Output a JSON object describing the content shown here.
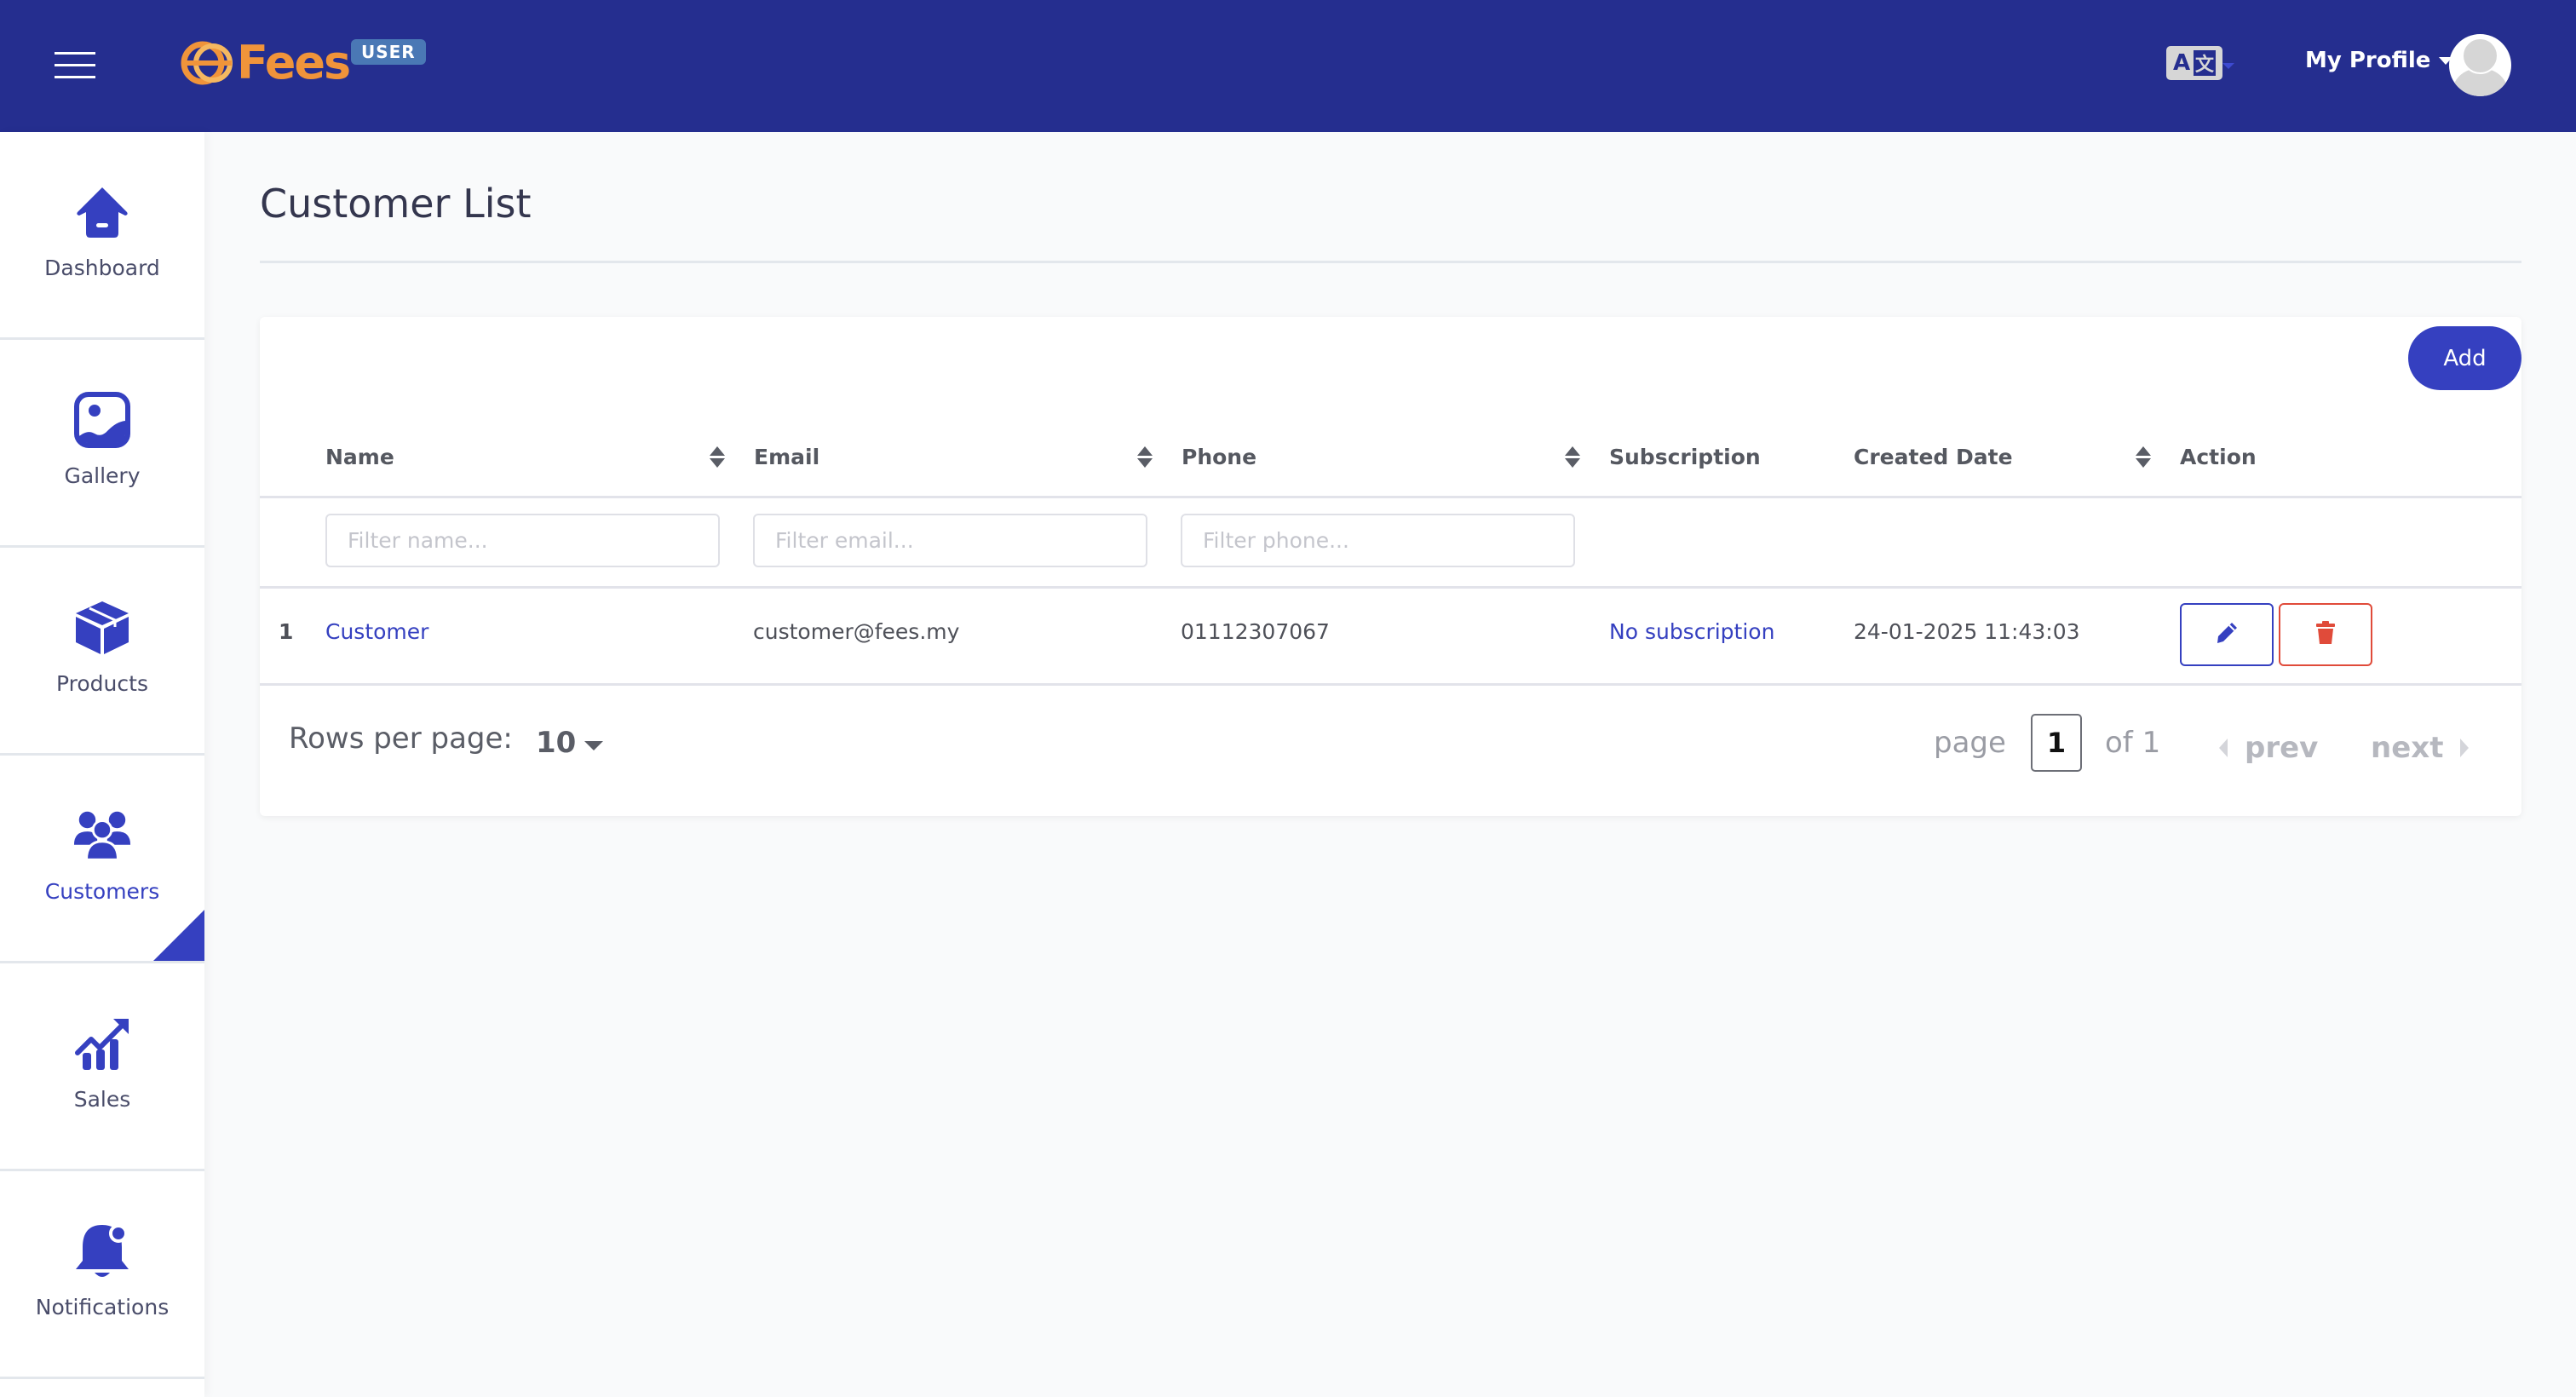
{
  "header": {
    "brand": "Fees",
    "role_badge": "USER",
    "language_icon": {
      "latin": "A",
      "cjk": "文"
    },
    "profile_label": "My Profile"
  },
  "sidebar": {
    "items": [
      {
        "label": "Dashboard",
        "icon": "home-icon",
        "active": false
      },
      {
        "label": "Gallery",
        "icon": "image-icon",
        "active": false
      },
      {
        "label": "Products",
        "icon": "box-icon",
        "active": false
      },
      {
        "label": "Customers",
        "icon": "users-icon",
        "active": true
      },
      {
        "label": "Sales",
        "icon": "chart-growth-icon",
        "active": false
      },
      {
        "label": "Notifications",
        "icon": "bell-icon",
        "active": false
      }
    ]
  },
  "page": {
    "title": "Customer List",
    "add_label": "Add"
  },
  "table": {
    "columns": [
      {
        "label": "Name",
        "sortable": true
      },
      {
        "label": "Email",
        "sortable": true
      },
      {
        "label": "Phone",
        "sortable": true
      },
      {
        "label": "Subscription",
        "sortable": false
      },
      {
        "label": "Created Date",
        "sortable": true
      },
      {
        "label": "Action",
        "sortable": false
      }
    ],
    "filters": {
      "name_placeholder": "Filter name...",
      "email_placeholder": "Filter email...",
      "phone_placeholder": "Filter phone..."
    },
    "rows": [
      {
        "index": "1",
        "name": "Customer",
        "email": "customer@fees.my",
        "phone": "01112307067",
        "subscription": "No subscription",
        "created_date": "24-01-2025 11:43:03"
      }
    ]
  },
  "pagination": {
    "rows_per_page_label": "Rows per page:",
    "rows_per_page": "10",
    "page_label": "page",
    "current_page": "1",
    "of_label": "of 1",
    "prev_label": "prev",
    "next_label": "next"
  },
  "colors": {
    "header_bg": "#252e8f",
    "accent": "#3540c0",
    "danger": "#e04b3a",
    "brand_orange": "#f0943a",
    "badge": "#4a78b5"
  }
}
